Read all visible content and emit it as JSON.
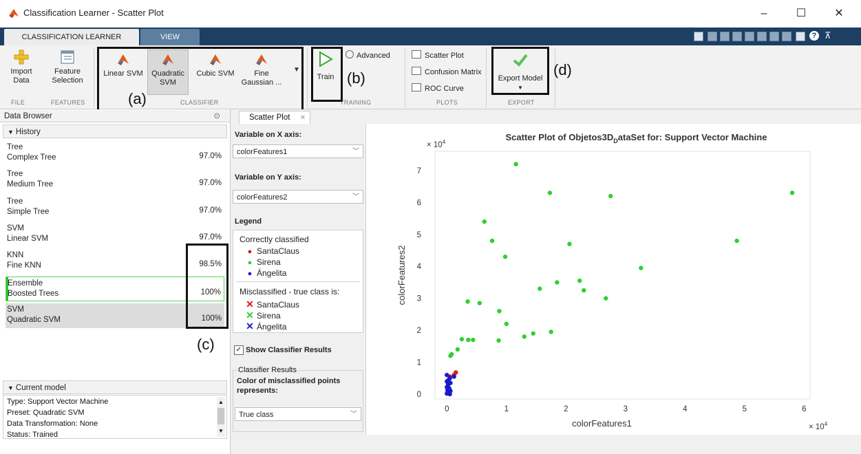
{
  "window": {
    "title": "Classification Learner - Scatter Plot",
    "controls": [
      "–",
      "☐",
      "✕"
    ]
  },
  "tabs": {
    "classification_learner": "CLASSIFICATION LEARNER",
    "view": "VIEW"
  },
  "ribbon": {
    "import_data": [
      "Import",
      "Data"
    ],
    "feature_selection": [
      "Feature",
      "Selection"
    ],
    "classifiers": [
      {
        "line1": "Linear SVM",
        "line2": ""
      },
      {
        "line1": "Quadratic",
        "line2": "SVM"
      },
      {
        "line1": "Cubic SVM",
        "line2": ""
      },
      {
        "line1": "Fine",
        "line2": "Gaussian ..."
      }
    ],
    "advanced": "Advanced",
    "train": "Train",
    "plots": [
      "Scatter Plot",
      "Confusion Matrix",
      "ROC Curve"
    ],
    "export_model": "Export Model",
    "sections": {
      "file": "FILE",
      "features": "FEATURES",
      "classifier": "CLASSIFIER",
      "training": "TRAINING",
      "plots": "PLOTS",
      "export": "EXPORT"
    }
  },
  "callouts": {
    "a": "(a)",
    "b": "(b)",
    "c": "(c)",
    "d": "(d)"
  },
  "data_browser": {
    "title": "Data Browser",
    "history_label": "History",
    "history": [
      {
        "category": "Tree",
        "model": "Complex Tree",
        "accuracy": "97.0%",
        "state": "normal"
      },
      {
        "category": "Tree",
        "model": "Medium Tree",
        "accuracy": "97.0%",
        "state": "normal"
      },
      {
        "category": "Tree",
        "model": "Simple Tree",
        "accuracy": "97.0%",
        "state": "normal"
      },
      {
        "category": "SVM",
        "model": "Linear SVM",
        "accuracy": "97.0%",
        "state": "normal"
      },
      {
        "category": "KNN",
        "model": "Fine KNN",
        "accuracy": "98.5%",
        "state": "normal"
      },
      {
        "category": "Ensemble",
        "model": "Boosted Trees",
        "accuracy": "100%",
        "state": "best"
      },
      {
        "category": "SVM",
        "model": "Quadratic SVM",
        "accuracy": "100%",
        "state": "selected"
      }
    ],
    "current_model_label": "Current model",
    "current_model": [
      "Type: Support Vector Machine",
      "Preset: Quadratic SVM",
      "Data Transformation: None",
      "Status: Trained"
    ]
  },
  "scatter_tab": {
    "label": "Scatter Plot"
  },
  "options": {
    "x_axis_label": "Variable on X axis:",
    "x_axis_value": "colorFeatures1",
    "y_axis_label": "Variable on Y axis:",
    "y_axis_value": "colorFeatures2",
    "legend_label": "Legend",
    "correct_label": "Correctly classified",
    "mis_label": "Misclassified - true class is:",
    "classes": [
      {
        "name": "SantaClaus",
        "color": "#d41a1a"
      },
      {
        "name": "Sirena",
        "color": "#2ed12e"
      },
      {
        "name": "Ángelita",
        "color": "#1a1acc"
      }
    ],
    "show_results": "Show Classifier Results",
    "results_group": "Classifier Results",
    "color_mis": "Color of misclassified points represents:",
    "color_mis_value": "True class"
  },
  "chart_data": {
    "type": "scatter",
    "title": "Scatter Plot of Objetos3D",
    "title_sub": "D",
    "title_rest": "ataSet for: Support Vector Machine",
    "xlabel": "colorFeatures1",
    "ylabel": "colorFeatures2",
    "x_multiplier": "× 10",
    "y_multiplier": "× 10",
    "multiplier_exp": "4",
    "xlim": [
      -0.2,
      6.1
    ],
    "ylim": [
      -0.15,
      7.6
    ],
    "xticks": [
      0,
      1,
      2,
      3,
      4,
      5,
      6
    ],
    "yticks": [
      0,
      1,
      2,
      3,
      4,
      5,
      6,
      7
    ],
    "series": [
      {
        "name": "Sirena",
        "color": "#2ed12e",
        "points": [
          [
            1.16,
            7.2
          ],
          [
            0.63,
            5.4
          ],
          [
            0.76,
            4.8
          ],
          [
            0.98,
            4.3
          ],
          [
            1.73,
            6.3
          ],
          [
            2.75,
            6.2
          ],
          [
            5.8,
            6.3
          ],
          [
            4.87,
            4.8
          ],
          [
            2.06,
            4.7
          ],
          [
            3.26,
            3.95
          ],
          [
            1.85,
            3.5
          ],
          [
            2.23,
            3.55
          ],
          [
            2.3,
            3.25
          ],
          [
            1.56,
            3.3
          ],
          [
            2.67,
            3.0
          ],
          [
            0.35,
            2.9
          ],
          [
            0.55,
            2.85
          ],
          [
            0.88,
            2.6
          ],
          [
            1.0,
            2.2
          ],
          [
            0.25,
            1.72
          ],
          [
            0.36,
            1.7
          ],
          [
            0.44,
            1.7
          ],
          [
            0.87,
            1.68
          ],
          [
            1.3,
            1.8
          ],
          [
            1.45,
            1.9
          ],
          [
            1.75,
            1.95
          ],
          [
            0.18,
            1.4
          ],
          [
            0.08,
            1.25
          ],
          [
            0.06,
            1.2
          ]
        ]
      },
      {
        "name": "SantaClaus",
        "color": "#d41a1a",
        "points": [
          [
            0.15,
            0.68
          ],
          [
            0.12,
            0.6
          ],
          [
            0.05,
            0.55
          ]
        ]
      },
      {
        "name": "Ángelita",
        "color": "#1a1acc",
        "points": [
          [
            0.0,
            0.6
          ],
          [
            0.05,
            0.5
          ],
          [
            0.03,
            0.45
          ],
          [
            0.0,
            0.4
          ],
          [
            0.06,
            0.35
          ],
          [
            0.02,
            0.3
          ],
          [
            0.0,
            0.22
          ],
          [
            0.04,
            0.18
          ],
          [
            0.01,
            0.12
          ],
          [
            0.03,
            0.05
          ],
          [
            0.0,
            0.02
          ],
          [
            0.05,
            0.0
          ],
          [
            0.12,
            0.55
          ],
          [
            0.02,
            0.25
          ],
          [
            0.06,
            0.1
          ]
        ]
      }
    ]
  }
}
